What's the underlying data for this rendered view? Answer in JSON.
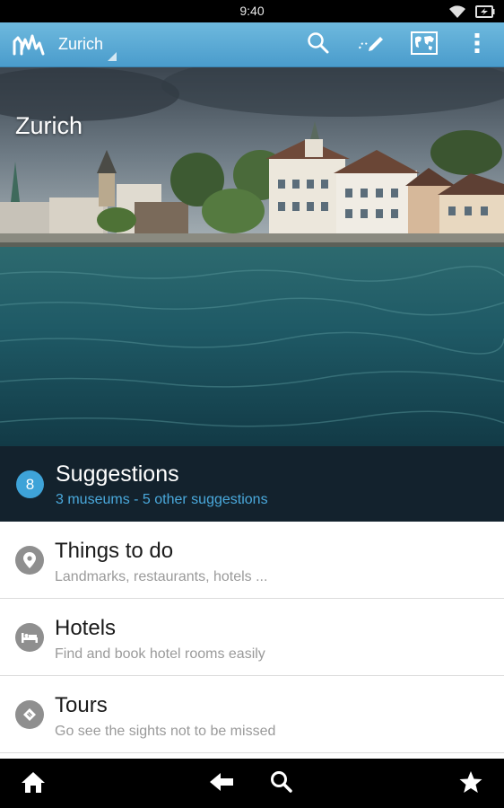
{
  "status_bar": {
    "time": "9:40"
  },
  "action_bar": {
    "city": "Zurich",
    "icons": [
      "app-logo-icon",
      "search-icon",
      "edit-pencil-icon",
      "world-map-icon",
      "overflow-menu-icon"
    ]
  },
  "hero": {
    "title": "Zurich"
  },
  "suggestions": {
    "count": "8",
    "title": "Suggestions",
    "subtitle": "3 museums - 5 other suggestions",
    "badge_color": "#3ea3d8"
  },
  "items": [
    {
      "title": "Things to do",
      "subtitle": "Landmarks, restaurants, hotels ...",
      "icon": "location-pin-icon"
    },
    {
      "title": "Hotels",
      "subtitle": "Find and book hotel rooms easily",
      "icon": "bed-icon"
    },
    {
      "title": "Tours",
      "subtitle": "Go see the sights not to be missed",
      "icon": "ticket-icon"
    }
  ],
  "nav_bar": {
    "icons": [
      "home-icon",
      "back-icon",
      "search-icon",
      "star-icon"
    ]
  },
  "colors": {
    "action_bar": "#5aaad6",
    "suggestions_bg": "#13222d",
    "accent": "#4aa9dc"
  }
}
